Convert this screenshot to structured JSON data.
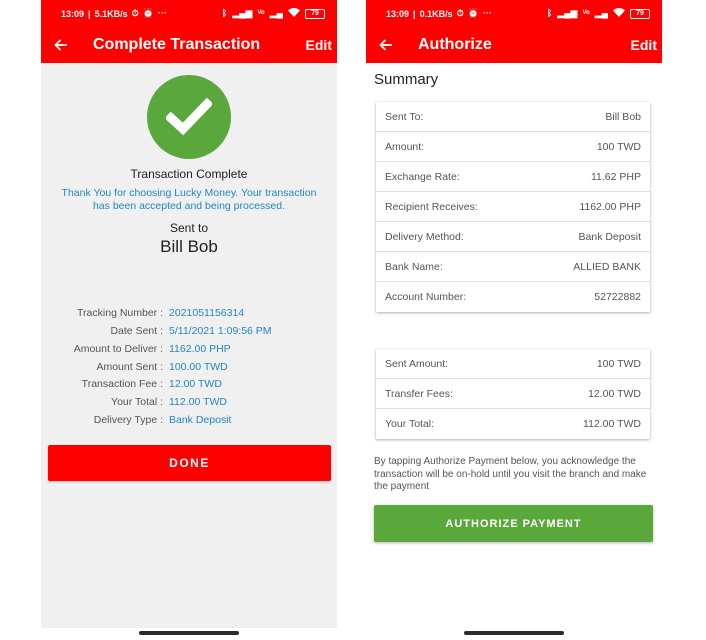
{
  "left_screen": {
    "status_bar": {
      "time": "13:09",
      "net_speed": "5.1KB/s",
      "battery": "79",
      "icons": [
        "bluetooth-icon",
        "signal-icon",
        "volte-icon",
        "wifi-icon",
        "battery-icon"
      ]
    },
    "app_bar": {
      "title": "Complete Transaction",
      "edit_label": "Edit"
    },
    "success": {
      "title": "Transaction Complete",
      "message": "Thank You for choosing Lucky Money. Your transaction has been accepted and being processed.",
      "sent_to_label": "Sent to",
      "recipient_name": "Bill Bob"
    },
    "details": [
      {
        "label": "Tracking Number :",
        "value": "2021051156314"
      },
      {
        "label": "Date Sent :",
        "value": "5/11/2021 1:09:56 PM"
      },
      {
        "label": "Amount to Deliver :",
        "value": "1162.00 PHP"
      },
      {
        "label": "Amount Sent :",
        "value": "100.00 TWD"
      },
      {
        "label": "Transaction Fee :",
        "value": "12.00 TWD"
      },
      {
        "label": "Your Total :",
        "value": "112.00 TWD"
      },
      {
        "label": "Delivery Type :",
        "value": "Bank Deposit"
      }
    ],
    "done_label": "DONE"
  },
  "right_screen": {
    "status_bar": {
      "time": "13:09",
      "net_speed": "0.1KB/s",
      "battery": "79"
    },
    "app_bar": {
      "title": "Authorize",
      "edit_label": "Edit"
    },
    "summary_title": "Summary",
    "summary_card": [
      {
        "label": "Sent To:",
        "value": "Bill Bob"
      },
      {
        "label": "Amount:",
        "value": "100 TWD"
      },
      {
        "label": "Exchange Rate:",
        "value": "11.62 PHP"
      },
      {
        "label": "Recipient Receives:",
        "value": "1162.00 PHP"
      },
      {
        "label": "Delivery Method:",
        "value": "Bank Deposit"
      },
      {
        "label": "Bank Name:",
        "value": "ALLIED BANK"
      },
      {
        "label": "Account Number:",
        "value": "52722882"
      }
    ],
    "totals_card": [
      {
        "label": "Sent Amount:",
        "value": "100 TWD"
      },
      {
        "label": "Transfer Fees:",
        "value": "12.00 TWD"
      },
      {
        "label": "Your Total:",
        "value": "112.00 TWD"
      }
    ],
    "disclaimer": "By tapping Authorize Payment below, you acknowledge the transaction will be on-hold until you visit the branch and make the payment",
    "authorize_label": "AUTHORIZE PAYMENT"
  },
  "colors": {
    "brand_red": "#ff0000",
    "success_green": "#5aa83c",
    "link_blue": "#1f86c4"
  }
}
